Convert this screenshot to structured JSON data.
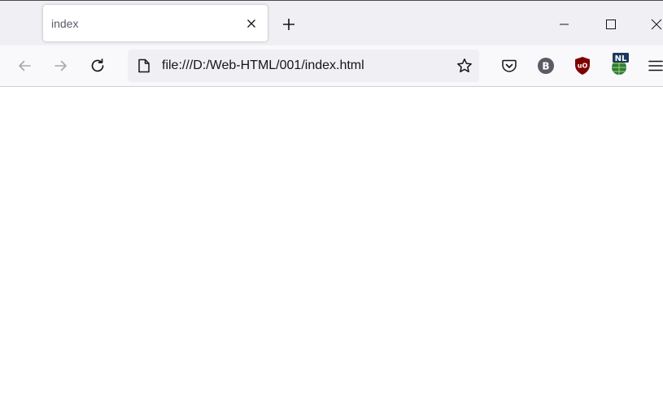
{
  "tabs": [
    {
      "title": "index",
      "active": true
    }
  ],
  "url_bar": {
    "url": "file:///D:/Web-HTML/001/index.html"
  },
  "toolbar": {
    "extensions": [
      {
        "name": "pocket-icon"
      },
      {
        "name": "b-extension-icon",
        "label": "B"
      },
      {
        "name": "ublock-origin-icon",
        "label": "uO"
      },
      {
        "name": "nl-globe-extension-icon",
        "label": "NL"
      }
    ]
  },
  "page": {
    "content": ""
  },
  "colors": {
    "tabstrip_bg": "#f0f0f4",
    "navbar_bg": "#f9f9fb",
    "urlbar_bg": "#f0f0f4",
    "icon": "#15141a",
    "ublock_red": "#800000",
    "nl_navy": "#1b3a5c"
  }
}
